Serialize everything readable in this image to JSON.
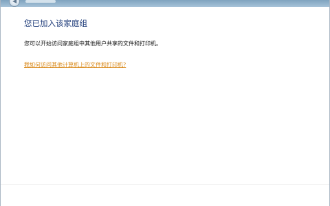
{
  "window": {
    "heading": "您已加入该家庭组",
    "description": "您可以开始访问家庭组中其他用户共享的文件和打印机。",
    "help_link": "我如何访问其他计算机上的文件和打印机?"
  },
  "titlebar": {
    "back_icon": "back-arrow-icon"
  },
  "colors": {
    "heading": "#1f3c7a",
    "link": "#d9891a",
    "text": "#111111"
  }
}
